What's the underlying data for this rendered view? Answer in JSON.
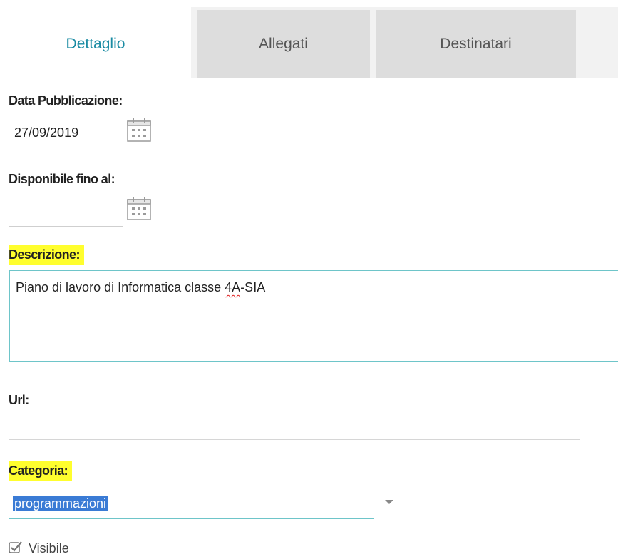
{
  "tabs": [
    {
      "label": "Dettaglio",
      "active": true
    },
    {
      "label": "Allegati",
      "active": false
    },
    {
      "label": "Destinatari",
      "active": false
    }
  ],
  "form": {
    "data_pubblicazione": {
      "label": "Data Pubblicazione:",
      "value": "27/09/2019"
    },
    "disponibile_fino_al": {
      "label": "Disponibile fino al:",
      "value": ""
    },
    "descrizione": {
      "label": "Descrizione:",
      "value_pre": "Piano di lavoro di Informatica classe ",
      "value_misspelled": "4A",
      "value_post": "-SIA",
      "highlighted": true
    },
    "url": {
      "label": "Url:",
      "value": ""
    },
    "categoria": {
      "label": "Categoria:",
      "selected": "programmazioni",
      "highlighted": true
    },
    "visibile": {
      "label": "Visibile",
      "checked": true
    }
  },
  "icons": {
    "calendar": "calendar-icon",
    "dropdown": "chevron-down-icon",
    "checkbox": "checkbox-checked-icon"
  },
  "colors": {
    "tab_active_text": "#1a8ba3",
    "highlight": "#fffe2e",
    "focus_border": "#6ec5c9",
    "selection": "#3a7bd5"
  }
}
